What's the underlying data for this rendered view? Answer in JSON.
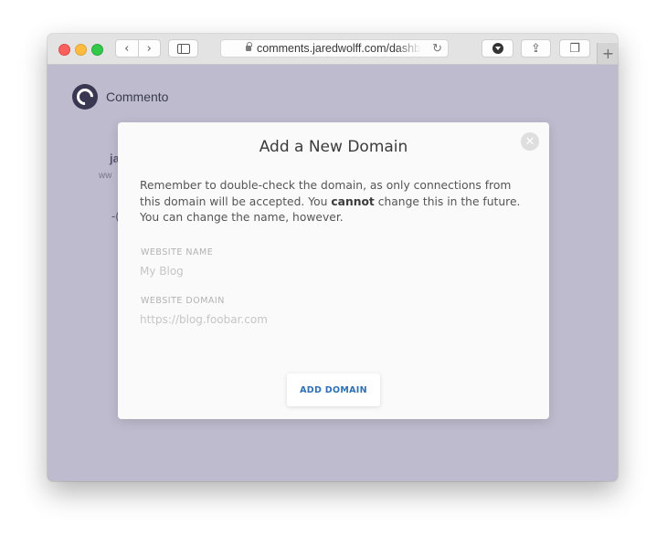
{
  "browser": {
    "url": "comments.jaredwolff.com/dashboard",
    "back_icon": "‹",
    "forward_icon": "›",
    "reload_icon": "↻",
    "share_icon": "⇪",
    "tabs_icon": "❐",
    "newtab_icon": "+"
  },
  "app": {
    "brand": "Commento",
    "bg_fragment_1": "ja",
    "bg_fragment_2": "ww",
    "bg_fragment_3": "-("
  },
  "modal": {
    "title": "Add a New Domain",
    "close_icon": "✕",
    "desc_part1": "Remember to double-check the domain, as only connections from this domain will be accepted. You ",
    "desc_bold": "cannot",
    "desc_part2": " change this in the future. You can change the name, however.",
    "website_name_label": "WEBSITE NAME",
    "website_name_placeholder": "My Blog",
    "website_domain_label": "WEBSITE DOMAIN",
    "website_domain_placeholder": "https://blog.foobar.com",
    "submit_label": "ADD DOMAIN"
  },
  "colors": {
    "accent": "#2f6fb3",
    "backdrop": "#bdbbcd",
    "logo": "#3a3753"
  }
}
